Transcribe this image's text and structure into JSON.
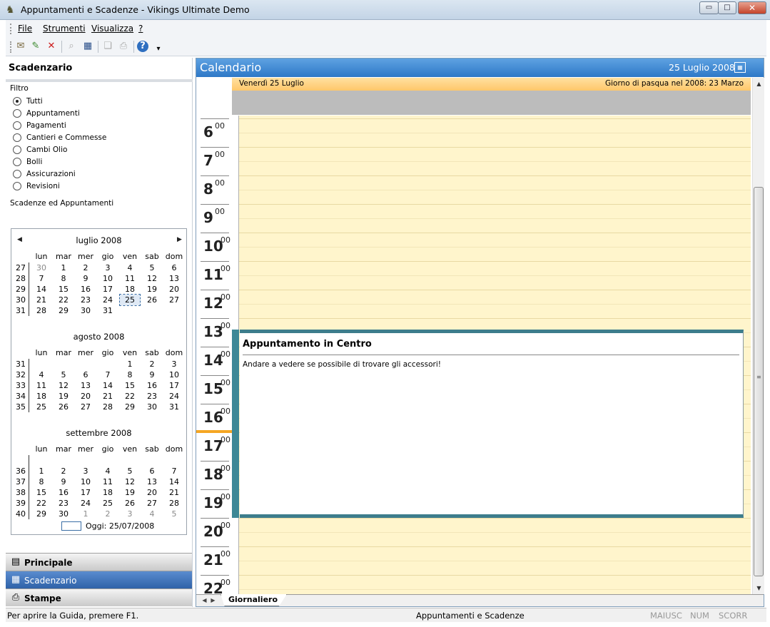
{
  "window": {
    "title": "Appuntamenti e Scadenze - Vikings Ultimate Demo",
    "controls": {
      "minimize": "▭",
      "maximize": "□",
      "close": "✕"
    }
  },
  "menu": {
    "items": [
      {
        "label": "File"
      },
      {
        "label": "Strumenti"
      },
      {
        "label": "Visualizza"
      },
      {
        "label": "?"
      }
    ]
  },
  "toolbar": {
    "buttons": [
      {
        "icon": "new-appointment-icon",
        "glyph": "✉"
      },
      {
        "icon": "edit-icon",
        "glyph": "✎"
      },
      {
        "icon": "delete-icon",
        "glyph": "✕"
      },
      {
        "icon": "search-icon",
        "glyph": "⌕"
      },
      {
        "icon": "calendar-view-icon",
        "glyph": "▦"
      },
      {
        "icon": "print-preview-icon",
        "glyph": "❏"
      },
      {
        "icon": "print-icon",
        "glyph": "⎙"
      },
      {
        "icon": "help-icon",
        "glyph": "?"
      },
      {
        "icon": "overflow-icon",
        "glyph": "▾"
      }
    ]
  },
  "left_panel": {
    "title": "Scadenzario",
    "filter_label": "Filtro",
    "filters": [
      {
        "label": "Tutti",
        "checked": true
      },
      {
        "label": "Appuntamenti",
        "checked": false
      },
      {
        "label": "Pagamenti",
        "checked": false
      },
      {
        "label": "Cantieri e Commesse",
        "checked": false
      },
      {
        "label": "Cambi Olio",
        "checked": false
      },
      {
        "label": "Bolli",
        "checked": false
      },
      {
        "label": "Assicurazioni",
        "checked": false
      },
      {
        "label": "Revisioni",
        "checked": false
      }
    ],
    "section_label": "Scadenze ed Appuntamenti",
    "calendar": {
      "prev": "◀",
      "next": "▶",
      "weekdays": [
        "lun",
        "mar",
        "mer",
        "gio",
        "ven",
        "sab",
        "dom"
      ],
      "months": [
        {
          "title": "luglio 2008",
          "weeks": [
            {
              "week": "27",
              "days": [
                "30",
                "1",
                "2",
                "3",
                "4",
                "5",
                "6"
              ],
              "gray": [
                0
              ]
            },
            {
              "week": "28",
              "days": [
                "7",
                "8",
                "9",
                "10",
                "11",
                "12",
                "13"
              ],
              "gray": []
            },
            {
              "week": "29",
              "days": [
                "14",
                "15",
                "16",
                "17",
                "18",
                "19",
                "20"
              ],
              "gray": []
            },
            {
              "week": "30",
              "days": [
                "21",
                "22",
                "23",
                "24",
                "25",
                "26",
                "27"
              ],
              "gray": [],
              "today": 4
            },
            {
              "week": "31",
              "days": [
                "28",
                "29",
                "30",
                "31",
                "",
                "",
                ""
              ],
              "gray": []
            }
          ]
        },
        {
          "title": "agosto 2008",
          "weeks": [
            {
              "week": "31",
              "days": [
                "",
                "",
                "",
                "",
                "1",
                "2",
                "3"
              ],
              "gray": []
            },
            {
              "week": "32",
              "days": [
                "4",
                "5",
                "6",
                "7",
                "8",
                "9",
                "10"
              ],
              "gray": []
            },
            {
              "week": "33",
              "days": [
                "11",
                "12",
                "13",
                "14",
                "15",
                "16",
                "17"
              ],
              "gray": []
            },
            {
              "week": "34",
              "days": [
                "18",
                "19",
                "20",
                "21",
                "22",
                "23",
                "24"
              ],
              "gray": []
            },
            {
              "week": "35",
              "days": [
                "25",
                "26",
                "27",
                "28",
                "29",
                "30",
                "31"
              ],
              "gray": []
            }
          ]
        },
        {
          "title": "settembre 2008",
          "weeks": [
            {
              "week": "",
              "days": [
                "",
                "",
                "",
                "",
                "",
                "",
                ""
              ],
              "gray": []
            },
            {
              "week": "36",
              "days": [
                "1",
                "2",
                "3",
                "4",
                "5",
                "6",
                "7"
              ],
              "gray": []
            },
            {
              "week": "37",
              "days": [
                "8",
                "9",
                "10",
                "11",
                "12",
                "13",
                "14"
              ],
              "gray": []
            },
            {
              "week": "38",
              "days": [
                "15",
                "16",
                "17",
                "18",
                "19",
                "20",
                "21"
              ],
              "gray": []
            },
            {
              "week": "39",
              "days": [
                "22",
                "23",
                "24",
                "25",
                "26",
                "27",
                "28"
              ],
              "gray": []
            },
            {
              "week": "40",
              "days": [
                "29",
                "30",
                "1",
                "2",
                "3",
                "4",
                "5"
              ],
              "gray": [
                2,
                3,
                4,
                5,
                6
              ]
            }
          ]
        }
      ],
      "today_label": "Oggi: 25/07/2008"
    },
    "nav_buttons": [
      {
        "label": "Principale",
        "icon": "principale-icon",
        "glyph": "▤",
        "active": false
      },
      {
        "label": "Scadenzario",
        "icon": "scadenzario-icon",
        "glyph": "▦",
        "active": true
      },
      {
        "label": "Stampe",
        "icon": "printer-icon",
        "glyph": "⎙",
        "active": false
      }
    ]
  },
  "calendar_panel": {
    "title": "Calendario",
    "current_date": "25 Luglio 2008",
    "date_picker_icon": "▦",
    "day_label": "Venerdì 25  Luglio",
    "easter_label": "Giorno di pasqua nel 2008: 23 Marzo",
    "hours": [
      "6",
      "7",
      "8",
      "9",
      "10",
      "11",
      "12",
      "13",
      "14",
      "15",
      "16",
      "17",
      "18",
      "19",
      "20",
      "21",
      "22"
    ],
    "minutes_label": "00",
    "appointment": {
      "title": "Appuntamento in Centro",
      "description": "Andare a vedere se possibile di trovare gli accessori!"
    },
    "tab": "Giornaliero",
    "tab_prev": "◀",
    "tab_next": "▶",
    "scroll_up": "▲",
    "scroll_down": "▼",
    "scroll_grip": "≡"
  },
  "statusbar": {
    "help_text": "Per aprire la Guida, premere F1.",
    "middle_text": "Appuntamenti e Scadenze",
    "caps": "MAIUSC",
    "num": "NUM",
    "scroll": "SCORR"
  },
  "colors": {
    "header_blue": "#2e78c7",
    "slot_yellow": "#fff5cc",
    "appointment_teal": "#3d7d8c",
    "day_strip_orange": "#ffc76a"
  }
}
